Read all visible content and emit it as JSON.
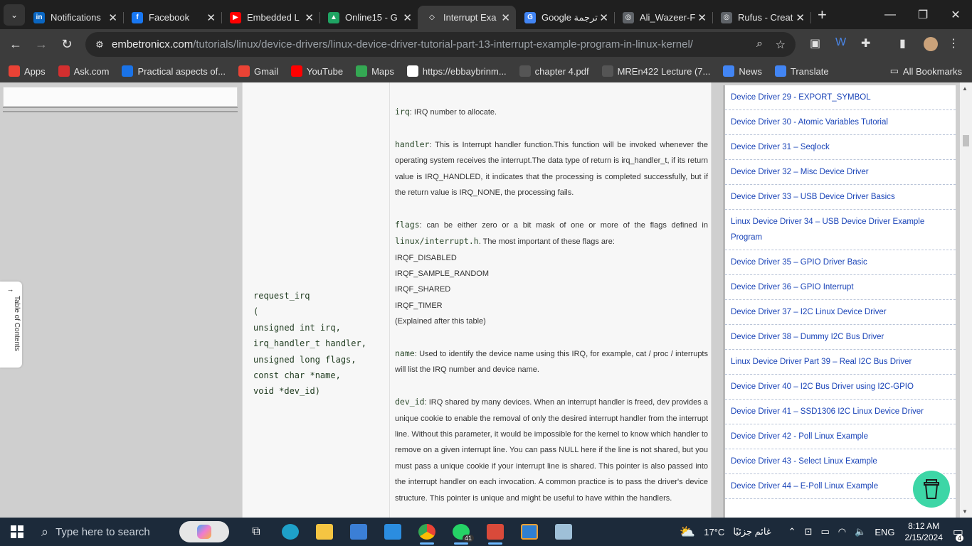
{
  "tabs": [
    {
      "title": "Notifications",
      "fav_color": "#0a66c2",
      "fav": "in"
    },
    {
      "title": "Facebook",
      "fav_color": "#1877f2",
      "fav": "f"
    },
    {
      "title": "Embedded L",
      "fav_color": "#ff0000",
      "fav": "▶"
    },
    {
      "title": "Online15 - G",
      "fav_color": "#1fa463",
      "fav": "▲"
    },
    {
      "title": "Interrupt Exa",
      "fav_color": "#3c3c3c",
      "fav": "◇"
    },
    {
      "title": "Google ترجمة",
      "fav_color": "#4285f4",
      "fav": "G"
    },
    {
      "title": "Ali_Wazeer-F",
      "fav_color": "#5f6368",
      "fav": "◎"
    },
    {
      "title": "Rufus - Creat",
      "fav_color": "#5f6368",
      "fav": "◎"
    }
  ],
  "omnibox": {
    "domain": "embetronicx.com",
    "path": "/tutorials/linux/device-drivers/linux-device-driver-tutorial-part-13-interrupt-example-program-in-linux-kernel/"
  },
  "bookmarks": [
    {
      "label": "Apps",
      "color": "#e94235"
    },
    {
      "label": "Ask.com",
      "color": "#d32f2f"
    },
    {
      "label": "Practical aspects of...",
      "color": "#1a73e8"
    },
    {
      "label": "Gmail",
      "color": "#ea4335"
    },
    {
      "label": "YouTube",
      "color": "#ff0000"
    },
    {
      "label": "Maps",
      "color": "#34a853"
    },
    {
      "label": "https://ebbaybrinm...",
      "color": "#ffffff"
    },
    {
      "label": "chapter 4.pdf",
      "color": "#555555"
    },
    {
      "label": "MREn422 Lecture (7...",
      "color": "#555555"
    },
    {
      "label": "News",
      "color": "#4285f4"
    },
    {
      "label": "Translate",
      "color": "#4285f4"
    }
  ],
  "all_bookmarks": "All Bookmarks",
  "toc_label": "Table of Contents",
  "function_signature": [
    "request_irq",
    "(",
    "unsigned int irq,",
    "irq_handler_t handler,",
    "unsigned long flags,",
    "const char *name,",
    "void *dev_id)"
  ],
  "desc": {
    "irq_kw": "irq",
    "irq_text": ": IRQ number to allocate.",
    "handler_kw": "handler",
    "handler_text": ": This is Interrupt handler function.This function will be invoked whenever the operating system receives the interrupt.The data type of return is irq_handler_t, if its return value is IRQ_HANDLED, it indicates that the processing is completed successfully, but if the return value is IRQ_NONE, the processing fails.",
    "flags_kw": "flags",
    "flags_text1": ": can be either zero or a bit mask of one or more of the flags defined in ",
    "flags_file": "linux/interrupt.h",
    "flags_text2": ". The most important of these flags are:",
    "flag1": "IRQF_DISABLED",
    "flag2": "IRQF_SAMPLE_RANDOM",
    "flag3": "IRQF_SHARED",
    "flag4": "IRQF_TIMER",
    "flags_note": "(Explained after this table)",
    "name_kw": "name",
    "name_text": ": Used to identify the device name using this IRQ, for example, cat / proc / interrupts will list the IRQ number and device name.",
    "devid_kw": "dev_id",
    "devid_text": ": IRQ shared by many devices. When an interrupt handler is freed, dev provides a unique cookie to enable the removal of only the desired interrupt handler from the interrupt line. Without this parameter, it would be impossible for the kernel to know which handler to remove on a given interrupt line. You can pass NULL here if the line is not shared, but you must pass a unique cookie if your interrupt line is shared. This pointer is also passed into the interrupt handler on each invocation. A common practice is to pass the driver's device structure. This pointer is unique and might be useful to have within the handlers."
  },
  "sidebar": [
    "Device Driver 29 - EXPORT_SYMBOL",
    "Device Driver 30 - Atomic Variables Tutorial",
    "Device Driver 31 – Seqlock",
    "Device Driver 32 – Misc Device Driver",
    "Device Driver 33 – USB Device Driver Basics",
    "Linux Device Driver 34 – USB Device Driver Example Program",
    "Device Driver 35 – GPIO Driver Basic",
    "Device Driver 36 – GPIO Interrupt",
    "Device Driver 37 – I2C Linux Device Driver",
    "Device Driver 38 – Dummy I2C Bus Driver",
    "Linux Device Driver Part 39 – Real I2C Bus Driver",
    "Device Driver 40 – I2C Bus Driver using I2C-GPIO",
    "Device Driver 41 – SSD1306 I2C Linux Device Driver",
    "Device Driver 42 - Poll Linux Example",
    "Device Driver 43 - Select Linux Example",
    "Device Driver 44 – E-Poll Linux Example"
  ],
  "taskbar": {
    "search_placeholder": "Type here to search",
    "weather": "17°C",
    "weather_text": "غائم جزئيًا",
    "lang": "ENG",
    "time": "8:12 AM",
    "date": "2/15/2024",
    "whatsapp_badge": "41",
    "notif_count": "4"
  }
}
